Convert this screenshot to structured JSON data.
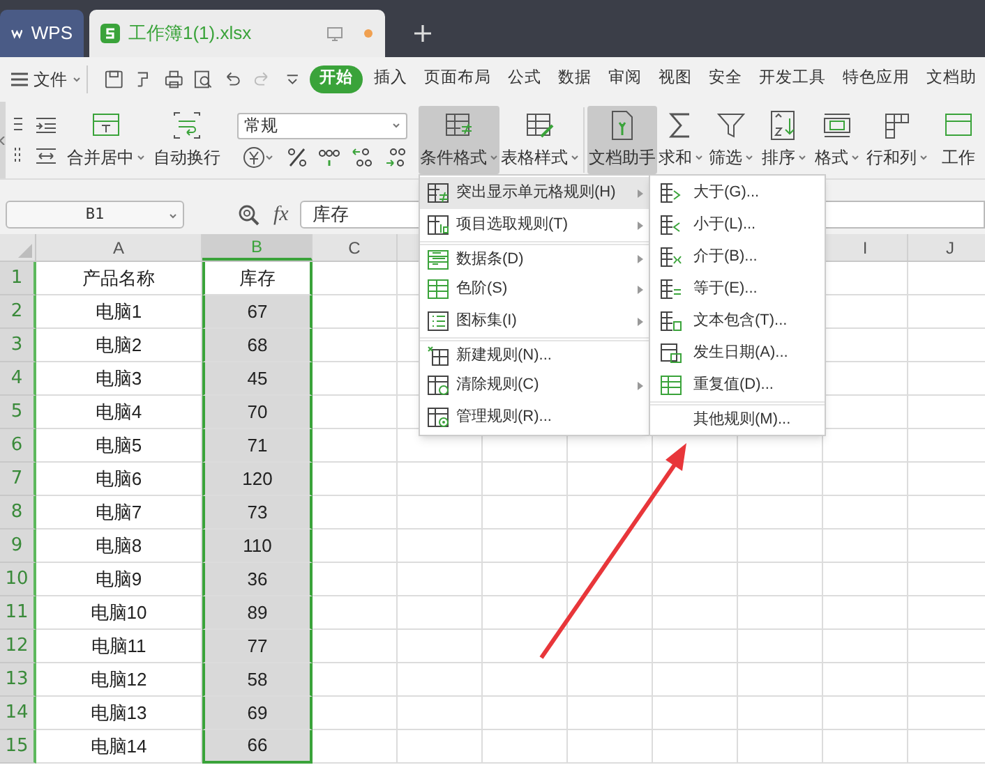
{
  "tabs": [
    {
      "label": "WPS",
      "kind": "home",
      "selected": false
    },
    {
      "label": "工作簿1(1).xlsx",
      "kind": "file",
      "selected": true
    }
  ],
  "menu_bar": {
    "file": "文件",
    "items": [
      {
        "label": "开始",
        "selected": true
      },
      {
        "label": "插入",
        "selected": false
      },
      {
        "label": "页面布局",
        "selected": false
      },
      {
        "label": "公式",
        "selected": false
      },
      {
        "label": "数据",
        "selected": false
      },
      {
        "label": "审阅",
        "selected": false
      },
      {
        "label": "视图",
        "selected": false
      },
      {
        "label": "安全",
        "selected": false
      },
      {
        "label": "开发工具",
        "selected": false
      },
      {
        "label": "特色应用",
        "selected": false
      },
      {
        "label": "文档助",
        "selected": false
      }
    ]
  },
  "ribbon": {
    "merge": "合并居中",
    "wrap": "自动换行",
    "number_format": "常规",
    "tools": [
      {
        "label": "条件格式",
        "pressed": true,
        "dropdown": true
      },
      {
        "label": "表格样式",
        "pressed": false,
        "dropdown": true
      },
      {
        "label": "文档助手",
        "pressed": true,
        "dropdown": false
      },
      {
        "label": "求和",
        "pressed": false,
        "dropdown": true
      },
      {
        "label": "筛选",
        "pressed": false,
        "dropdown": true
      },
      {
        "label": "排序",
        "pressed": false,
        "dropdown": true
      },
      {
        "label": "格式",
        "pressed": false,
        "dropdown": true
      },
      {
        "label": "行和列",
        "pressed": false,
        "dropdown": true
      },
      {
        "label": "工作",
        "pressed": false,
        "dropdown": false
      }
    ]
  },
  "formula_bar": {
    "name_box": "B1",
    "function_label": "fx",
    "value": "库存"
  },
  "sheet": {
    "columns": [
      {
        "label": "A",
        "selected": false
      },
      {
        "label": "B",
        "selected": true
      },
      {
        "label": "C",
        "selected": false
      },
      {},
      {},
      {},
      {},
      {},
      {
        "label": "I",
        "selected": false
      },
      {
        "label": "J",
        "selected": false
      }
    ],
    "rows": [
      {
        "number": "1",
        "active": true,
        "cells": [
          "产品名称",
          "库存"
        ]
      },
      {
        "number": "2",
        "active": false,
        "cells": [
          "电脑1",
          "67"
        ]
      },
      {
        "number": "3",
        "active": false,
        "cells": [
          "电脑2",
          "68"
        ]
      },
      {
        "number": "4",
        "active": false,
        "cells": [
          "电脑3",
          "45"
        ]
      },
      {
        "number": "5",
        "active": false,
        "cells": [
          "电脑4",
          "70"
        ]
      },
      {
        "number": "6",
        "active": false,
        "cells": [
          "电脑5",
          "71"
        ]
      },
      {
        "number": "7",
        "active": false,
        "cells": [
          "电脑6",
          "120"
        ]
      },
      {
        "number": "8",
        "active": false,
        "cells": [
          "电脑7",
          "73"
        ]
      },
      {
        "number": "9",
        "active": false,
        "cells": [
          "电脑8",
          "110"
        ]
      },
      {
        "number": "10",
        "active": false,
        "cells": [
          "电脑9",
          "36"
        ]
      },
      {
        "number": "11",
        "active": false,
        "cells": [
          "电脑10",
          "89"
        ]
      },
      {
        "number": "12",
        "active": false,
        "cells": [
          "电脑11",
          "77"
        ]
      },
      {
        "number": "13",
        "active": false,
        "cells": [
          "电脑12",
          "58"
        ]
      },
      {
        "number": "14",
        "active": false,
        "cells": [
          "电脑13",
          "69"
        ]
      },
      {
        "number": "15",
        "active": false,
        "cells": [
          "电脑14",
          "66"
        ]
      }
    ]
  },
  "context_menu": {
    "items": [
      {
        "label": "突出显示单元格规则(H)",
        "submenu": true,
        "highlighted": true,
        "separator_before": false
      },
      {
        "label": "项目选取规则(T)",
        "submenu": true,
        "highlighted": false,
        "separator_before": false
      },
      {
        "label": "数据条(D)",
        "submenu": true,
        "highlighted": false,
        "separator_before": true
      },
      {
        "label": "色阶(S)",
        "submenu": true,
        "highlighted": false,
        "separator_before": false
      },
      {
        "label": "图标集(I)",
        "submenu": true,
        "highlighted": false,
        "separator_before": false
      },
      {
        "label": "新建规则(N)...",
        "submenu": false,
        "highlighted": false,
        "separator_before": true
      },
      {
        "label": "清除规则(C)",
        "submenu": true,
        "highlighted": false,
        "separator_before": false
      },
      {
        "label": "管理规则(R)...",
        "submenu": false,
        "highlighted": false,
        "separator_before": false
      }
    ]
  },
  "submenu": {
    "items": [
      {
        "label": "大于(G)...",
        "icon": true,
        "separator_before": false
      },
      {
        "label": "小于(L)...",
        "icon": true,
        "separator_before": false
      },
      {
        "label": "介于(B)...",
        "icon": true,
        "separator_before": false
      },
      {
        "label": "等于(E)...",
        "icon": true,
        "separator_before": false
      },
      {
        "label": "文本包含(T)...",
        "icon": true,
        "separator_before": false
      },
      {
        "label": "发生日期(A)...",
        "icon": true,
        "separator_before": false
      },
      {
        "label": "重复值(D)...",
        "icon": true,
        "separator_before": false
      },
      {
        "label": "其他规则(M)...",
        "icon": false,
        "separator_before": true
      }
    ]
  }
}
